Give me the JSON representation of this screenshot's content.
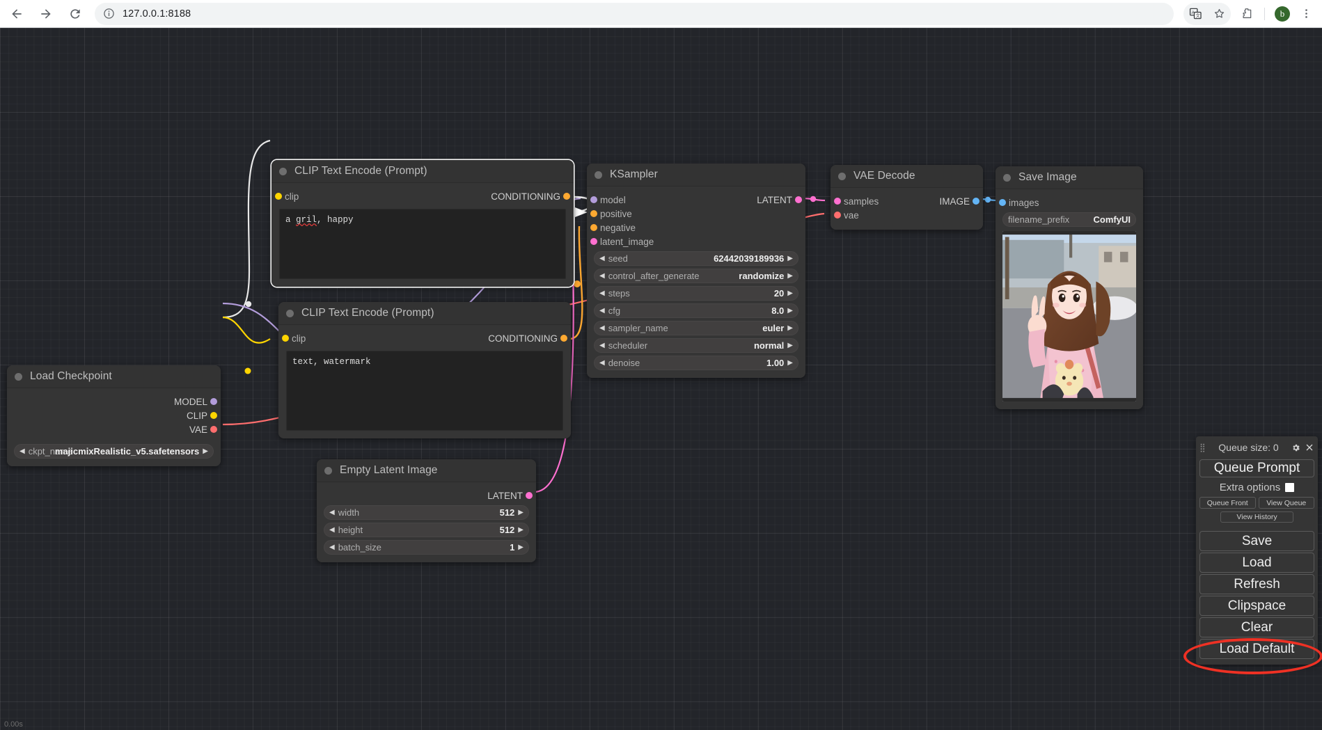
{
  "browser": {
    "url": "127.0.0.1:8188",
    "back_icon": "back-arrow-icon",
    "forward_icon": "forward-arrow-icon",
    "reload_icon": "reload-icon",
    "site_info_icon": "site-info-icon",
    "translate_icon": "translate-icon",
    "bookmark_icon": "star-icon",
    "extensions_icon": "extensions-puzzle-icon",
    "profile_initial": "b",
    "menu_icon": "three-dot-menu-icon"
  },
  "nodes": {
    "clip_positive": {
      "title": "CLIP Text Encode (Prompt)",
      "input_label": "clip",
      "output_label": "CONDITIONING",
      "text_before": "a ",
      "text_misspelled": "gril",
      "text_after": ", happy"
    },
    "clip_negative": {
      "title": "CLIP Text Encode (Prompt)",
      "input_label": "clip",
      "output_label": "CONDITIONING",
      "text": "text, watermark"
    },
    "ksampler": {
      "title": "KSampler",
      "inputs": [
        "model",
        "positive",
        "negative",
        "latent_image"
      ],
      "output_label": "LATENT",
      "widgets": [
        {
          "name": "seed",
          "value": "62442039189936"
        },
        {
          "name": "control_after_generate",
          "value": "randomize"
        },
        {
          "name": "steps",
          "value": "20"
        },
        {
          "name": "cfg",
          "value": "8.0"
        },
        {
          "name": "sampler_name",
          "value": "euler"
        },
        {
          "name": "scheduler",
          "value": "normal"
        },
        {
          "name": "denoise",
          "value": "1.00"
        }
      ]
    },
    "vae_decode": {
      "title": "VAE Decode",
      "inputs": [
        "samples",
        "vae"
      ],
      "output_label": "IMAGE"
    },
    "save_image": {
      "title": "Save Image",
      "input_label": "images",
      "widget_name": "filename_prefix",
      "widget_value": "ComfyUI"
    },
    "load_checkpoint": {
      "title": "Load Checkpoint",
      "outputs": [
        "MODEL",
        "CLIP",
        "VAE"
      ],
      "widget_name": "ckpt_name",
      "widget_value": "majicmixRealistic_v5.safetensors"
    },
    "empty_latent": {
      "title": "Empty Latent Image",
      "output_label": "LATENT",
      "widgets": [
        {
          "name": "width",
          "value": "512"
        },
        {
          "name": "height",
          "value": "512"
        },
        {
          "name": "batch_size",
          "value": "1"
        }
      ]
    }
  },
  "queue_panel": {
    "queue_size_label": "Queue size: 0",
    "drag_handle_icon": "drag-handle-icon",
    "settings_icon": "gear-icon",
    "close_icon": "close-icon",
    "queue_prompt": "Queue Prompt",
    "extra_options": "Extra options",
    "queue_front": "Queue Front",
    "view_queue": "View Queue",
    "view_history": "View History",
    "buttons": [
      "Save",
      "Load",
      "Refresh",
      "Clipspace",
      "Clear",
      "Load Default"
    ]
  },
  "status": {
    "bottom_left": "0.00s"
  },
  "colors": {
    "conditioning": "#ffa931",
    "model": "#b39ddb",
    "clip": "#ffd500",
    "vae": "#ff6e6e",
    "latent": "#ff70d0",
    "image": "#64b5f6",
    "annotation_red": "#ef3124",
    "node_bg": "#353535",
    "canvas_bg": "#23252a"
  },
  "arrows": {
    "left": "◀",
    "right": "▶"
  }
}
